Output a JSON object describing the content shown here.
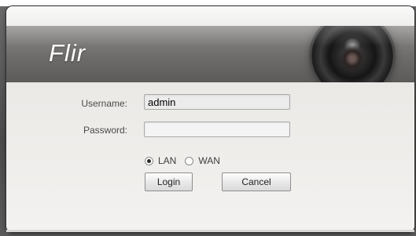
{
  "brand": {
    "logo_text": "Flir"
  },
  "login_form": {
    "username_label": "Username:",
    "username_value": "admin",
    "password_label": "Password:",
    "password_value": "",
    "network_options": [
      {
        "label": "LAN",
        "selected": true
      },
      {
        "label": "WAN",
        "selected": false
      }
    ],
    "login_button": "Login",
    "cancel_button": "Cancel"
  },
  "colors": {
    "banner": "#6e6c6a",
    "dialog_bg": "#f1f0ee",
    "outer_bg": "#5e5e5e"
  },
  "icons": {
    "banner_image": "camera-lens-icon"
  }
}
